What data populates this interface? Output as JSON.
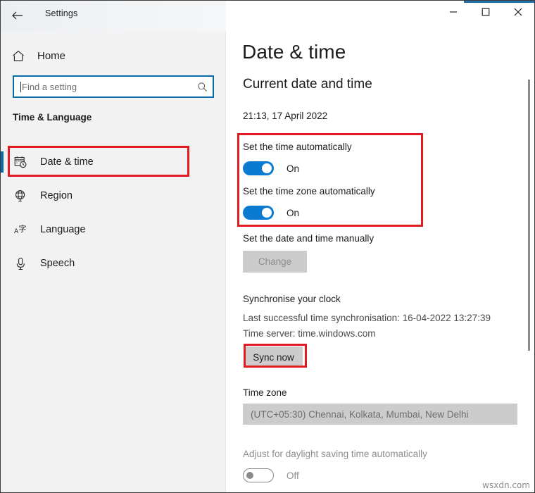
{
  "window": {
    "title": "Settings",
    "back_icon": "back-arrow-icon",
    "minimize_label": "Minimize",
    "maximize_label": "Maximize",
    "close_label": "Close",
    "accent_color": "#1f6fa8"
  },
  "sidebar": {
    "home_label": "Home",
    "home_icon": "home-icon",
    "search": {
      "placeholder": "Find a setting",
      "value": "",
      "icon": "search-icon"
    },
    "group_header": "Time & Language",
    "items": [
      {
        "label": "Date & time",
        "icon": "calendar-clock-icon",
        "selected": true
      },
      {
        "label": "Region",
        "icon": "globe-icon",
        "selected": false
      },
      {
        "label": "Language",
        "icon": "language-icon",
        "selected": false
      },
      {
        "label": "Speech",
        "icon": "microphone-icon",
        "selected": false
      }
    ]
  },
  "main": {
    "page_title": "Date & time",
    "section_title": "Current date and time",
    "current_datetime": "21:13, 17 April 2022",
    "set_time_auto": {
      "label": "Set the time automatically",
      "state": "On"
    },
    "set_timezone_auto": {
      "label": "Set the time zone automatically",
      "state": "On"
    },
    "set_manually": {
      "label": "Set the date and time manually",
      "button_label": "Change",
      "button_enabled": false
    },
    "sync": {
      "heading": "Synchronise your clock",
      "last_sync": "Last successful time synchronisation: 16-04-2022 13:27:39",
      "time_server": "Time server: time.windows.com",
      "button_label": "Sync now"
    },
    "time_zone": {
      "label": "Time zone",
      "selected": "(UTC+05:30) Chennai, Kolkata, Mumbai, New Delhi"
    },
    "daylight_saving": {
      "label": "Adjust for daylight saving time automatically",
      "state": "Off"
    }
  },
  "annotations": {
    "highlight_color": "#e01b22",
    "boxes": [
      "sidebar-date-time",
      "auto-time-toggles",
      "sync-now-button"
    ]
  },
  "watermark": "wsxdn.com"
}
